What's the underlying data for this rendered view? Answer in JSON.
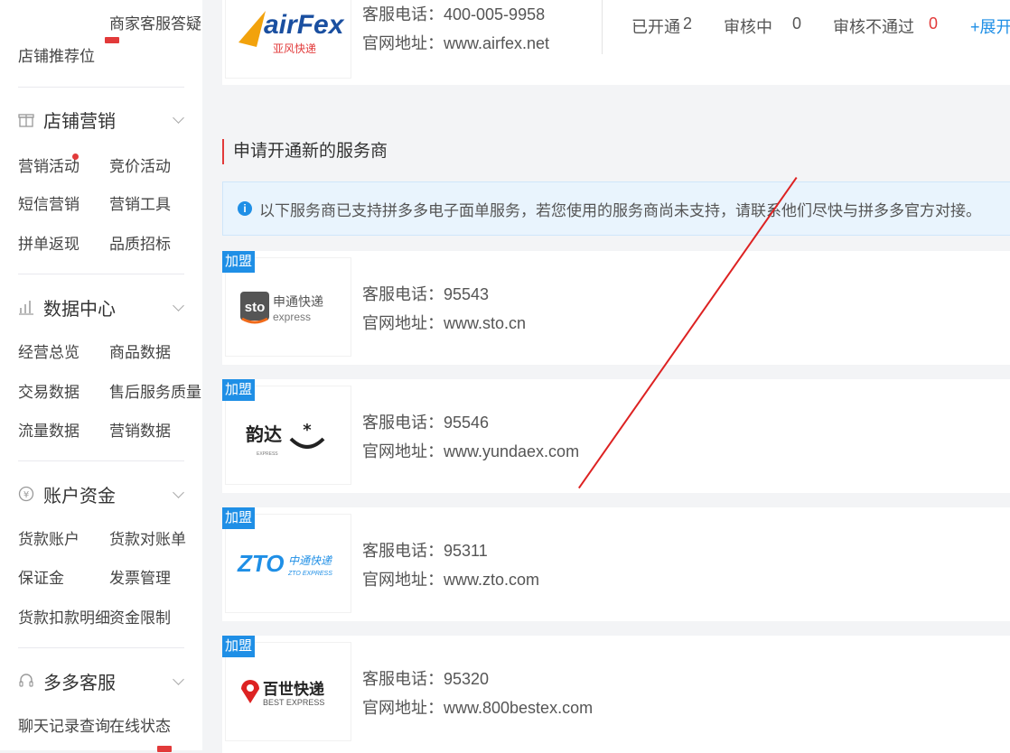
{
  "sidebar": {
    "top_items": [
      "店铺推荐位",
      "商家客服答疑"
    ],
    "sections": [
      {
        "title": "店铺营销",
        "icon": "gift-icon",
        "items": [
          "营销活动",
          "竞价活动",
          "短信营销",
          "营销工具",
          "拼单返现",
          "品质招标"
        ]
      },
      {
        "title": "数据中心",
        "icon": "bar-chart-icon",
        "items": [
          "经营总览",
          "商品数据",
          "交易数据",
          "售后服务质量",
          "流量数据",
          "营销数据"
        ]
      },
      {
        "title": "账户资金",
        "icon": "yen-coin-icon",
        "items": [
          "货款账户",
          "货款对账单",
          "保证金",
          "发票管理",
          "货款扣款明细",
          "资金限制"
        ]
      },
      {
        "title": "多多客服",
        "icon": "headset-icon",
        "items": [
          "聊天记录查询",
          "在线状态"
        ]
      }
    ]
  },
  "opened_carrier": {
    "logo_text": "airFex",
    "logo_sub": "亚风快递",
    "phone_label": "客服电话：",
    "phone": "400-005-9958",
    "site_label": "官网地址：",
    "site": "www.airfex.net",
    "stats": {
      "opened_label": "已开通",
      "opened": "2",
      "reviewing_label": "审核中",
      "reviewing": "0",
      "rejected_label": "审核不通过",
      "rejected": "0",
      "expand": "+展开"
    }
  },
  "apply_section": {
    "title": "申请开通新的服务商",
    "notice": "以下服务商已支持拼多多电子面单服务，若您使用的服务商尚未支持，请联系他们尽快与拼多多官方对接。"
  },
  "join_label": "加盟",
  "carriers": [
    {
      "name_cn": "申通快递",
      "name_en": "express",
      "logo_mark": "sto",
      "phone_label": "客服电话：",
      "phone": "95543",
      "site_label": "官网地址：",
      "site": "www.sto.cn"
    },
    {
      "name_cn": "韵达",
      "name_en": "EXPRESS",
      "logo_mark": "",
      "phone_label": "客服电话：",
      "phone": "95546",
      "site_label": "官网地址：",
      "site": "www.yundaex.com"
    },
    {
      "name_cn": "中通快递",
      "name_en": "ZTO EXPRESS",
      "logo_mark": "ZTO",
      "phone_label": "客服电话：",
      "phone": "95311",
      "site_label": "官网地址：",
      "site": "www.zto.com"
    },
    {
      "name_cn": "百世快递",
      "name_en": "BEST EXPRESS",
      "logo_mark": "",
      "phone_label": "客服电话：",
      "phone": "95320",
      "site_label": "官网地址：",
      "site": "www.800bestex.com"
    }
  ],
  "colors": {
    "accent_blue": "#1f8fe6",
    "accent_red": "#e23a3a"
  }
}
